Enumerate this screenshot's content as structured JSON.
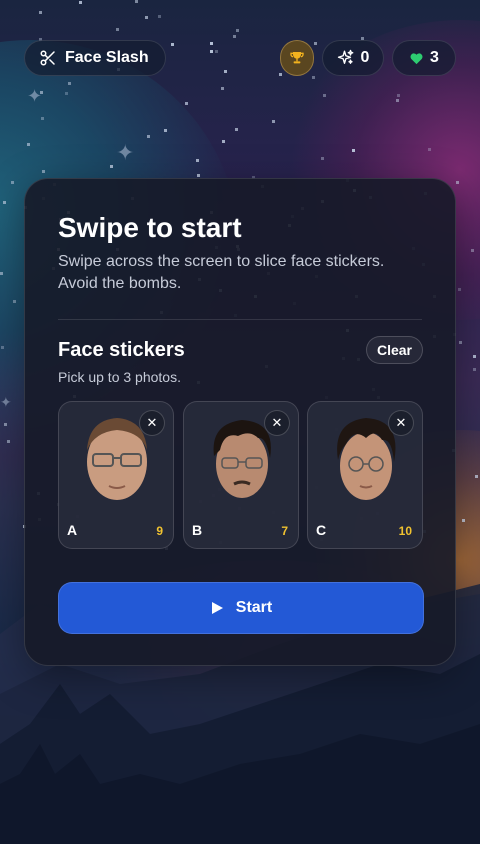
{
  "header": {
    "title": "Face Slash",
    "title_icon": "scissors-icon",
    "trophy_icon": "trophy-icon",
    "score": "0",
    "score_icon": "sparkles-icon",
    "lives": "3",
    "lives_icon": "heart-icon"
  },
  "card": {
    "heading": "Swipe to start",
    "subtext": "Swipe across the screen to slice face stickers. Avoid the bombs.",
    "section_title": "Face stickers",
    "clear_label": "Clear",
    "hint": "Pick up to 3 photos.",
    "stickers": [
      {
        "label": "A",
        "count": "9",
        "remove_label": "✕"
      },
      {
        "label": "B",
        "count": "7",
        "remove_label": "✕"
      },
      {
        "label": "C",
        "count": "10",
        "remove_label": "✕"
      }
    ],
    "start_label": "Start",
    "start_icon": "play-icon"
  },
  "colors": {
    "accent": "#2359d6",
    "count": "#f0c230",
    "heart": "#2ecc71",
    "trophy": "#f2b21e"
  }
}
